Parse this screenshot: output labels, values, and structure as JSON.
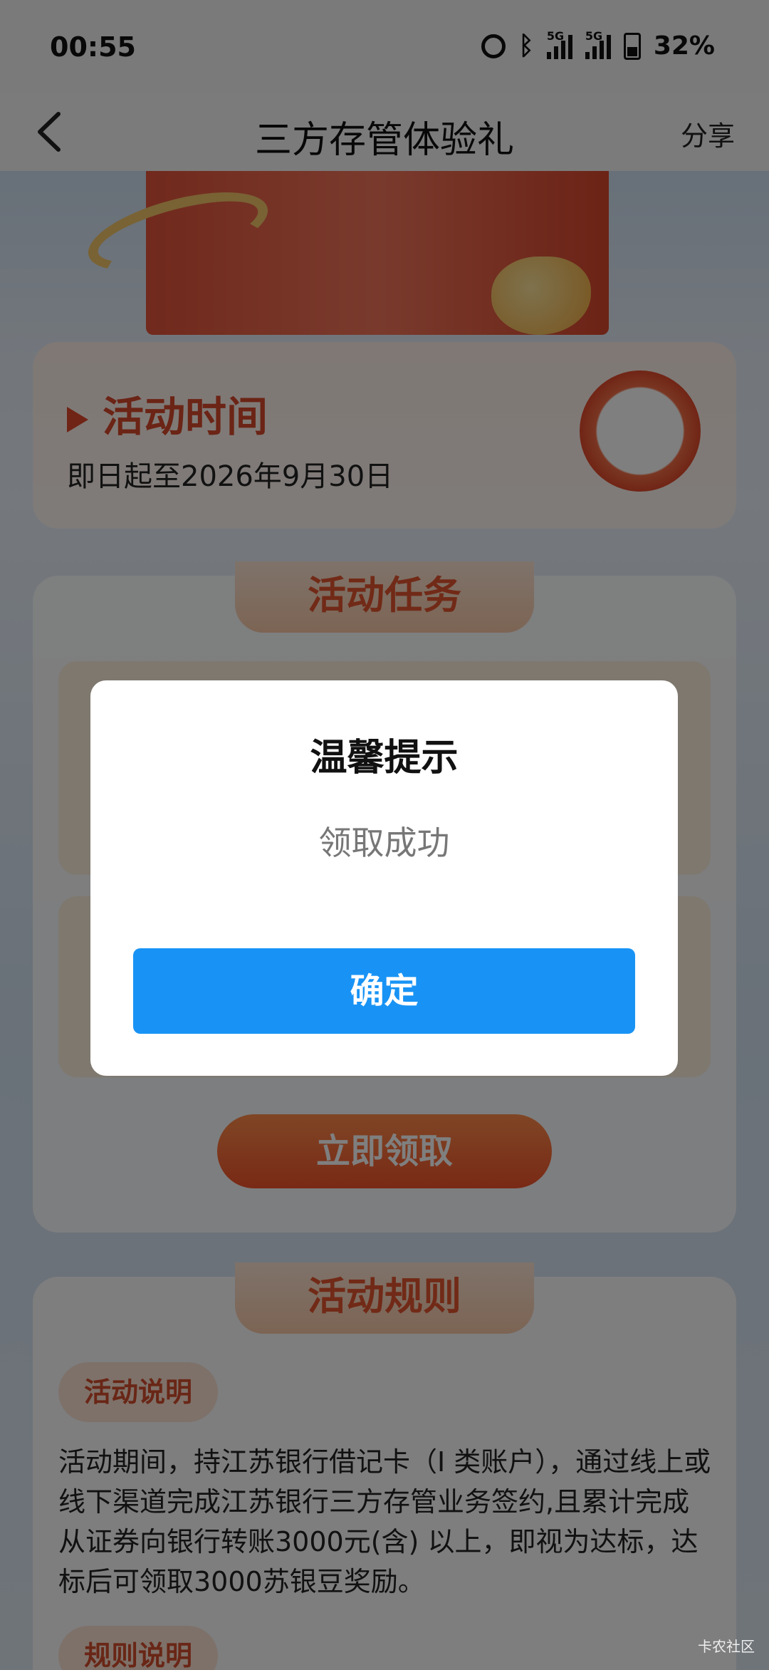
{
  "status_bar": {
    "time": "00:55",
    "battery": "32%",
    "network_1": "5G",
    "network_2": "5G"
  },
  "nav": {
    "title": "三方存管体验礼",
    "share_label": "分享"
  },
  "activity_time": {
    "title": "活动时间",
    "text": "即日起至2026年9月30日"
  },
  "task_section": {
    "title": "活动任务",
    "claim_label": "立即领取"
  },
  "rules_section": {
    "title": "活动规则",
    "desc_pill": "活动说明",
    "desc_text": "活动期间，持江苏银行借记卡（I 类账户），通过线上或线下渠道完成江苏银行三方存管业务签约,且累计完成从证券向银行转账3000元(含) 以上，即视为达标，达标后可领取3000苏银豆奖励。",
    "rules_pill": "规则说明"
  },
  "dialog": {
    "title": "温馨提示",
    "message": "领取成功",
    "confirm_label": "确定"
  },
  "watermark": "卡农社区",
  "colors": {
    "primary_button": "#1893f5",
    "accent_red": "#e2542f"
  }
}
